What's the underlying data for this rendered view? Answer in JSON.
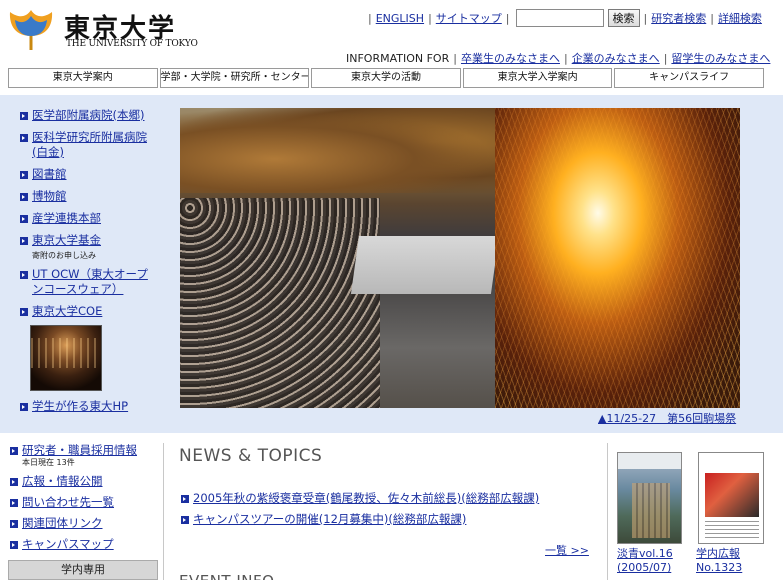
{
  "logo": {
    "title_ja": "東京大学",
    "title_en": "THE UNIVERSITY OF TOKYO",
    "accent": "#f0a020"
  },
  "toplinks": {
    "english": "ENGLISH",
    "sitemap": "サイトマップ",
    "search_value": "",
    "search_button": "検索",
    "researcher_search": "研究者検索",
    "advanced_search": "詳細検索"
  },
  "infofor": {
    "label": "INFORMATION FOR",
    "links": [
      "卒業生のみなさまへ",
      "企業のみなさまへ",
      "留学生のみなさまへ"
    ]
  },
  "gnav": [
    "東京大学案内",
    "学部・大学院・研究所・センター",
    "東京大学の活動",
    "東京大学入学案内",
    "キャンパスライフ"
  ],
  "side_links": [
    {
      "label": "医学部附属病院(本郷)"
    },
    {
      "label": "医科学研究所附属病院(白金)"
    },
    {
      "label": "図書館"
    },
    {
      "label": "博物館"
    },
    {
      "label": "産学連携本部"
    },
    {
      "label": "東京大学基金",
      "note": "寄附のお申し込み"
    },
    {
      "label": "UT OCW（東大オープンコースウェア）"
    },
    {
      "label": "東京大学COE"
    },
    {
      "label": "学生が作る東大HP"
    }
  ],
  "photo": {
    "caption": "▲11/25-27　第56回駒場祭"
  },
  "bottom_links": [
    {
      "label": "研究者・職員採用情報",
      "note": "本日現在 13件"
    },
    {
      "label": "広報・情報公開"
    },
    {
      "label": "問い合わせ先一覧"
    },
    {
      "label": "関連団体リンク"
    },
    {
      "label": "キャンパスマップ"
    }
  ],
  "staff_only": "学内専用",
  "news": {
    "heading": "NEWS & TOPICS",
    "items": [
      "2005年秋の紫綬褒章受章(鶴尾教授、佐々木前総長)(総務部広報課)",
      "キャンパスツアーの開催(12月募集中)(総務部広報課)"
    ],
    "more": "一覧 >>"
  },
  "event_heading": "EVENT INFO",
  "magazines": [
    {
      "line1": "淡青vol.16",
      "line2": "(2005/07)"
    },
    {
      "line1": "学内広報",
      "line2": "No.1323"
    }
  ]
}
